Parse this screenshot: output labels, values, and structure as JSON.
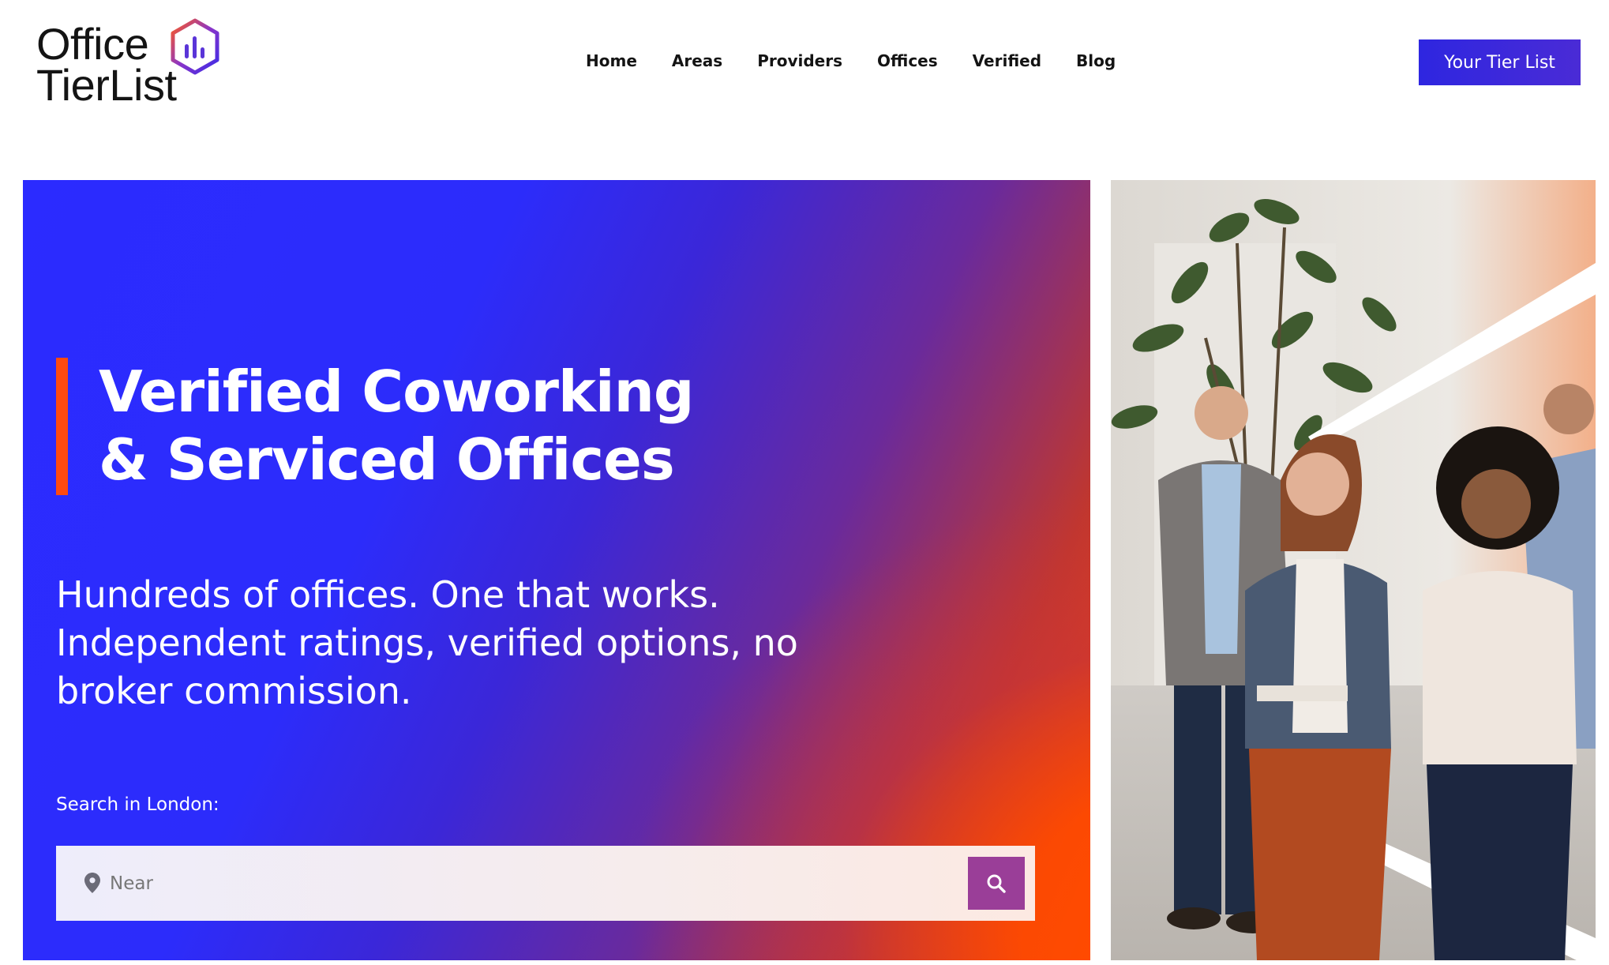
{
  "brand": {
    "logo_line1": "Office",
    "logo_line2": "TierList",
    "mark_icon": "hexagon-bar-chart-icon"
  },
  "nav": {
    "items": [
      "Home",
      "Areas",
      "Providers",
      "Offices",
      "Verified",
      "Blog"
    ]
  },
  "header": {
    "cta_label": "Your Tier List"
  },
  "hero": {
    "title_line1": "Verified Coworking",
    "title_line2": "& Serviced Offices",
    "subtitle_line1": "Hundreds of offices. One that works.",
    "subtitle_line2": "Independent ratings, verified options, no",
    "subtitle_line3": "broker commission.",
    "search_label": "Search in London:",
    "search_placeholder": "Near",
    "search_icon": "search-icon",
    "pin_icon": "location-pin-icon"
  },
  "photo": {
    "subject": "office-team-photo"
  },
  "colors": {
    "brand_blue": "#2e26e0",
    "hero_orange": "#ff4a00",
    "accent_bar": "#ff4a10",
    "search_button": "#9a3e98"
  }
}
